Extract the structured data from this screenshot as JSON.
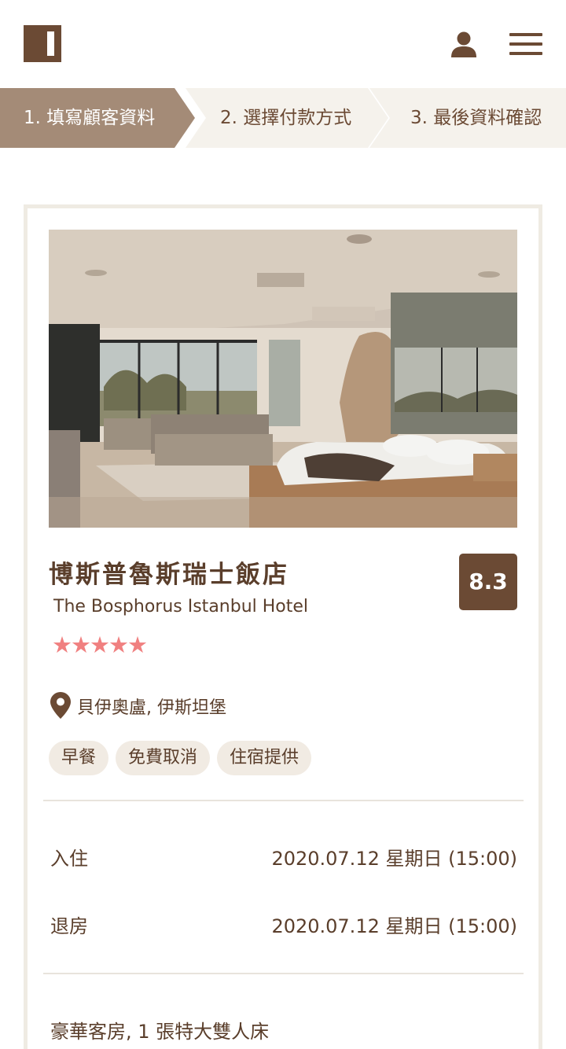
{
  "header": {
    "logo_icon": "brand-logo-icon",
    "user_icon": "user-icon",
    "menu_icon": "hamburger-menu-icon"
  },
  "steps": [
    {
      "label": "1. 填寫顧客資料",
      "active": true
    },
    {
      "label": "2. 選擇付款方式",
      "active": false
    },
    {
      "label": "3. 最後資料確認",
      "active": false
    }
  ],
  "hotel": {
    "name": "博斯普魯斯瑞士飯店",
    "name_en": "The Bosphorus Istanbul Hotel",
    "score": "8.3",
    "stars": 5,
    "location": "貝伊奧盧, 伊斯坦堡",
    "tags": [
      "早餐",
      "免費取消",
      "住宿提供"
    ]
  },
  "stay": {
    "checkin_label": "入住",
    "checkin_value": "2020.07.12 星期日 (15:00)",
    "checkout_label": "退房",
    "checkout_value": "2020.07.12 星期日 (15:00)"
  },
  "room": {
    "description": "豪華客房, 1 張特大雙人床"
  },
  "colors": {
    "brand": "#6b4a34",
    "step_active": "#a48b77",
    "step_inactive": "#f5f2ec",
    "star": "#f08080",
    "tag_bg": "#f1ebe3"
  }
}
